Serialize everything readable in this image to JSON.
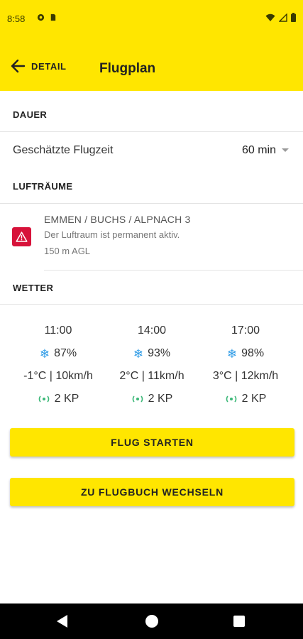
{
  "status_bar": {
    "time": "8:58",
    "left_icons": [
      "data-saver-icon",
      "sim-card-icon"
    ],
    "right_icons": [
      "wifi-icon",
      "cell-signal-icon",
      "battery-icon"
    ]
  },
  "app_bar": {
    "back_label": "DETAIL",
    "back_icon": "arrow-left-icon",
    "title": "Flugplan",
    "background_color": "#FFE600"
  },
  "duration": {
    "header": "DAUER",
    "label": "Geschätzte Flugzeit",
    "value": "60 min",
    "icon": "chevron-down-icon"
  },
  "airspaces": {
    "header": "LUFTRÄUME",
    "items": [
      {
        "name": "EMMEN / BUCHS / ALPNACH 3",
        "status": "Der Luftraum ist permanent aktiv.",
        "height": "150 m AGL",
        "icon": "warning-icon",
        "badge_color": "#D7123A"
      }
    ]
  },
  "weather": {
    "header": "WETTER",
    "forecasts": [
      {
        "time": "11:00",
        "precipitation": "87%",
        "temp_wind": "-1°C | 10km/h",
        "kp": "2 KP"
      },
      {
        "time": "14:00",
        "precipitation": "93%",
        "temp_wind": "2°C | 11km/h",
        "kp": "2 KP"
      },
      {
        "time": "17:00",
        "precipitation": "98%",
        "temp_wind": "3°C | 12km/h",
        "kp": "2 KP"
      }
    ],
    "precipitation_icon": "snowflake-icon",
    "kp_icon": "kp-index-icon",
    "snow_icon_color": "#2E9BE6",
    "kp_icon_color": "#3CB878"
  },
  "actions": {
    "start_flight": "FLUG STARTEN",
    "switch_logbook": "ZU FLUGBUCH WECHSELN",
    "button_color": "#FFE600"
  },
  "nav_bar": {
    "icons": [
      "nav-back-icon",
      "nav-home-icon",
      "nav-recents-icon"
    ]
  }
}
